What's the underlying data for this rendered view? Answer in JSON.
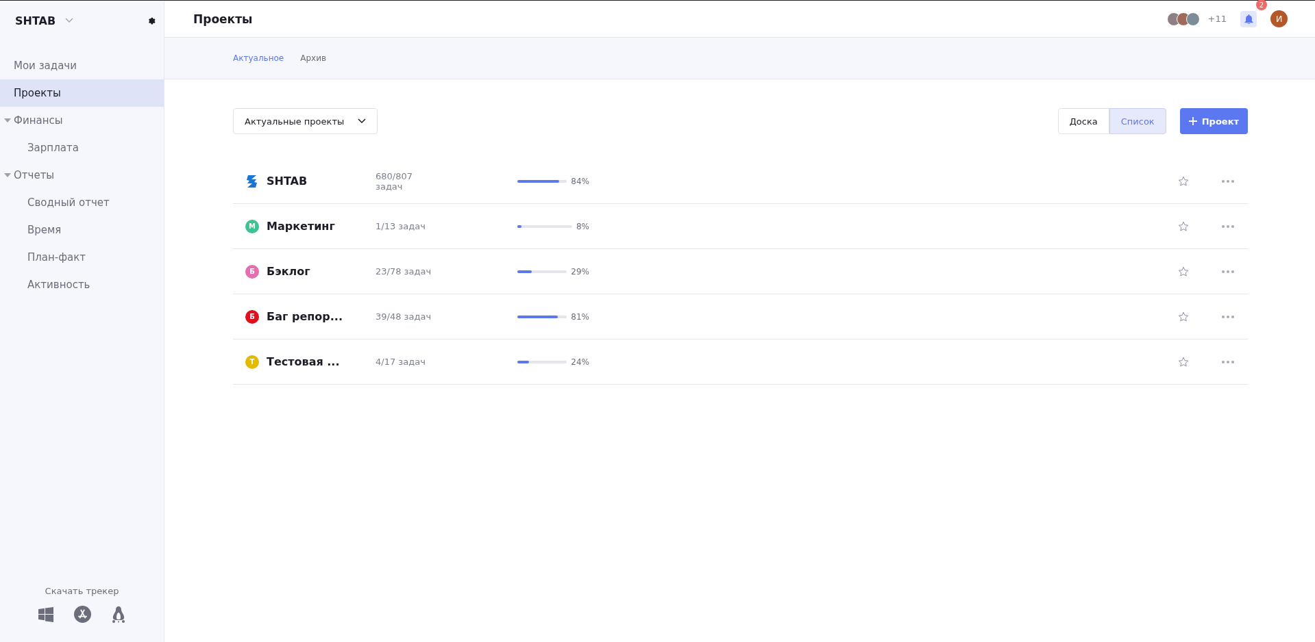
{
  "sidebar": {
    "workspace": "SHTAB",
    "items": [
      {
        "label": "Мои задачи",
        "selected": false
      },
      {
        "label": "Проекты",
        "selected": true
      },
      {
        "label": "Финансы",
        "selected": false,
        "expanded": true,
        "children": [
          {
            "label": "Зарплата",
            "selected": false
          }
        ]
      },
      {
        "label": "Отчеты",
        "selected": false,
        "expanded": true,
        "children": [
          {
            "label": "Сводный отчет",
            "selected": false
          },
          {
            "label": "Время",
            "selected": false
          },
          {
            "label": "План-факт",
            "selected": false
          },
          {
            "label": "Активность",
            "selected": false
          }
        ]
      }
    ],
    "download": {
      "label": "Скачать трекер",
      "platforms": [
        {
          "kind": "windows"
        },
        {
          "kind": "appstore"
        },
        {
          "kind": "linux"
        }
      ]
    }
  },
  "header": {
    "title": "Проекты",
    "members_more": "+11",
    "notifications": "2",
    "user_initial": "И"
  },
  "tabs": [
    {
      "label": "Актуальное",
      "selected": true
    },
    {
      "label": "Архив",
      "selected": false
    }
  ],
  "filter": {
    "value": "Актуальные проекты"
  },
  "view_toggle": [
    {
      "label": "Доска",
      "selected": false
    },
    {
      "label": "Список",
      "selected": true
    }
  ],
  "add_button": {
    "label": "Проект"
  },
  "projects": [
    {
      "kind": "logo",
      "name": "SHTAB",
      "tasks": "680/807 задач",
      "level": 0.84,
      "percent": "84%"
    },
    {
      "kind": "letter",
      "letter": "М",
      "color": "#3ec28f",
      "name": "Маркетинг",
      "tasks": "1/13 задач",
      "level": 0.08,
      "percent": "8%"
    },
    {
      "kind": "letter",
      "letter": "Б",
      "color": "#e46fae",
      "name": "Бэклог",
      "tasks": "23/78 задач",
      "level": 0.29,
      "percent": "29%"
    },
    {
      "kind": "letter",
      "letter": "Б",
      "color": "#e0101e",
      "name": "Баг репор...",
      "tasks": "39/48 задач",
      "level": 0.81,
      "percent": "81%"
    },
    {
      "kind": "letter",
      "letter": "Т",
      "color": "#e2bb00",
      "name": "Тестовая ...",
      "tasks": "4/17 задач",
      "level": 0.24,
      "percent": "24%"
    }
  ]
}
